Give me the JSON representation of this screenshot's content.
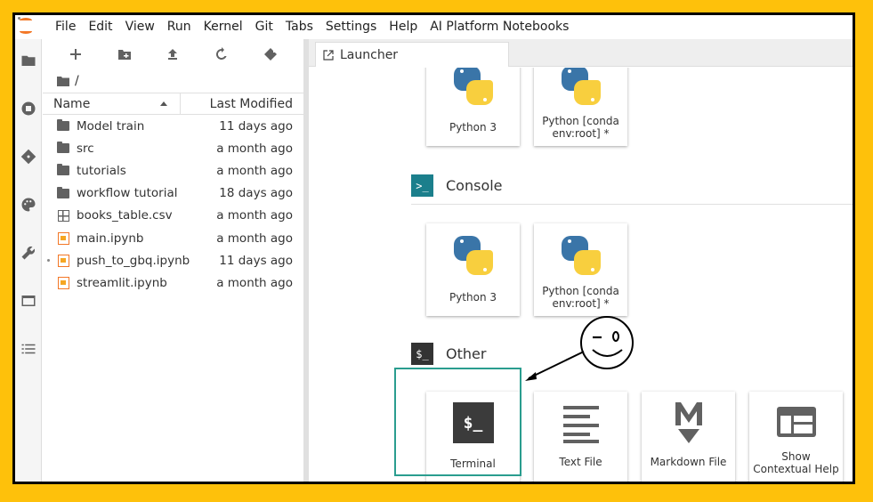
{
  "menu": [
    "File",
    "Edit",
    "View",
    "Run",
    "Kernel",
    "Git",
    "Tabs",
    "Settings",
    "Help",
    "AI Platform Notebooks"
  ],
  "filebrowser": {
    "path": "/",
    "columns": {
      "name": "Name",
      "modified": "Last Modified"
    },
    "files": [
      {
        "name": "Model train",
        "modified": "11 days ago",
        "type": "folder"
      },
      {
        "name": "src",
        "modified": "a month ago",
        "type": "folder"
      },
      {
        "name": "tutorials",
        "modified": "a month ago",
        "type": "folder"
      },
      {
        "name": "workflow tutorial",
        "modified": "18 days ago",
        "type": "folder"
      },
      {
        "name": "books_table.csv",
        "modified": "a month ago",
        "type": "csv"
      },
      {
        "name": "main.ipynb",
        "modified": "a month ago",
        "type": "notebook"
      },
      {
        "name": "push_to_gbq.ipynb",
        "modified": "11 days ago",
        "type": "notebook"
      },
      {
        "name": "streamlit.ipynb",
        "modified": "a month ago",
        "type": "notebook"
      }
    ]
  },
  "tab": {
    "label": "Launcher"
  },
  "launcher": {
    "notebook_cards": [
      "Python 3",
      "Python [conda env:root] *"
    ],
    "console": {
      "title": "Console",
      "icon_text": ">_",
      "cards": [
        "Python 3",
        "Python [conda env:root] *"
      ]
    },
    "other": {
      "title": "Other",
      "icon_text": "$_",
      "cards": [
        "Terminal",
        "Text File",
        "Markdown File",
        "Show Contextual Help"
      ]
    }
  },
  "colors": {
    "highlight": "#2A9D8F",
    "background": "#FEC10B",
    "jupyter_orange": "#F37726"
  }
}
